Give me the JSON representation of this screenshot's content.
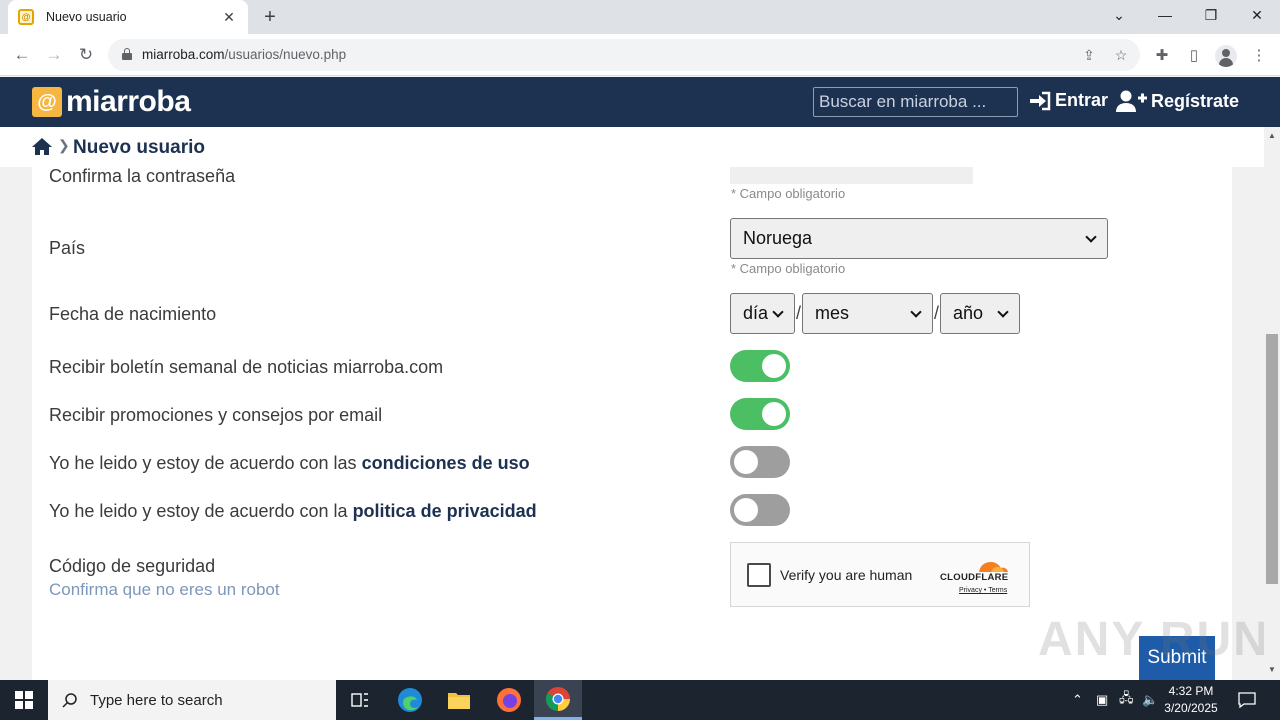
{
  "browser": {
    "tab_title": "Nuevo usuario",
    "url_domain": "miarroba.com",
    "url_path": "/usuarios/nuevo.php"
  },
  "site": {
    "logo_text": "miarroba",
    "search_placeholder": "Buscar en miarroba ...",
    "login_label": "Entrar",
    "register_label": "Regístrate",
    "brand_color": "#1d3151"
  },
  "breadcrumb": {
    "page_title": "Nuevo usuario"
  },
  "form": {
    "confirm_password_label": "Confirma la contraseña",
    "required_hint": "* Campo obligatorio",
    "country_label": "País",
    "country_value": "Noruega",
    "birthdate_label": "Fecha de nacimiento",
    "day_placeholder": "día",
    "month_placeholder": "mes",
    "year_placeholder": "año",
    "date_separator": "/",
    "newsletter_label": "Recibir boletín semanal de noticias miarroba.com",
    "newsletter_on": true,
    "promos_label": "Recibir promociones y consejos por email",
    "promos_on": true,
    "terms_prefix": "Yo he leido y estoy de acuerdo con las",
    "terms_link": "condiciones de uso",
    "terms_on": false,
    "privacy_prefix": "Yo he leido y estoy de acuerdo con la",
    "privacy_link": "politica de privacidad",
    "privacy_on": false,
    "security_label": "Código de seguridad",
    "security_sublabel": "Confirma que no eres un robot",
    "submit_label": "Submit"
  },
  "captcha": {
    "text": "Verify you are human",
    "brand": "CLOUDFLARE",
    "privacy": "Privacy",
    "separator": "•",
    "terms": "Terms"
  },
  "watermark": "ANY RUN",
  "taskbar": {
    "search_placeholder": "Type here to search",
    "time": "4:32 PM",
    "date": "3/20/2025"
  }
}
